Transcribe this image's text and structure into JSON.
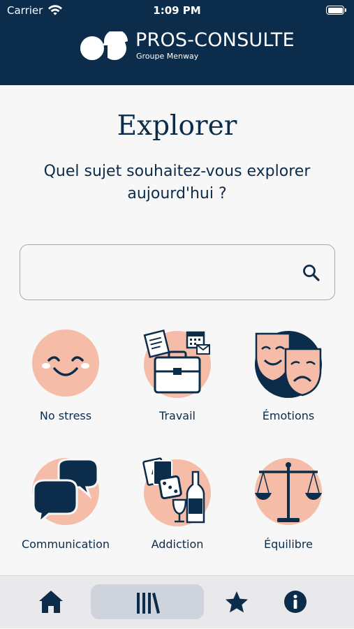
{
  "status_bar": {
    "carrier": "Carrier",
    "time": "1:09 PM",
    "battery_level": 1.0
  },
  "header": {
    "brand": "PROS-CONSULTE",
    "brand_sub": "Groupe Menway",
    "background_color": "#0b2c4a"
  },
  "main": {
    "title": "Explorer",
    "subtitle": "Quel sujet souhaitez-vous explorer aujourd'hui ?",
    "search": {
      "placeholder": "",
      "icon": "search-icon"
    }
  },
  "topics": [
    {
      "label": "No stress",
      "icon": "smiley-icon"
    },
    {
      "label": "Travail",
      "icon": "briefcase-icon"
    },
    {
      "label": "Émotions",
      "icon": "theater-masks-icon"
    },
    {
      "label": "Communication",
      "icon": "speech-bubbles-icon"
    },
    {
      "label": "Addiction",
      "icon": "dice-cards-bottle-icon"
    },
    {
      "label": "Équilibre",
      "icon": "balance-scale-icon"
    }
  ],
  "tabbar": {
    "tabs": [
      {
        "name": "home",
        "icon": "home-icon",
        "active": false
      },
      {
        "name": "library",
        "icon": "library-icon",
        "active": true
      },
      {
        "name": "favorites",
        "icon": "star-icon",
        "active": false
      },
      {
        "name": "info",
        "icon": "info-icon",
        "active": false
      }
    ]
  },
  "colors": {
    "navy": "#0b2c4a",
    "peach": "#f5bda8",
    "background": "#f7f7f8"
  }
}
